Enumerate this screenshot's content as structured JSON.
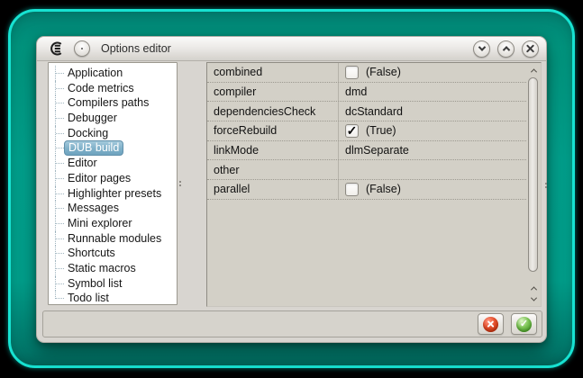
{
  "titlebar": {
    "title": "Options editor"
  },
  "sidebar": {
    "items": [
      {
        "label": "Application"
      },
      {
        "label": "Code metrics"
      },
      {
        "label": "Compilers paths"
      },
      {
        "label": "Debugger"
      },
      {
        "label": "Docking"
      },
      {
        "label": "DUB build",
        "selected": true
      },
      {
        "label": "Editor"
      },
      {
        "label": "Editor pages"
      },
      {
        "label": "Highlighter presets"
      },
      {
        "label": "Messages"
      },
      {
        "label": "Mini explorer"
      },
      {
        "label": "Runnable modules"
      },
      {
        "label": "Shortcuts"
      },
      {
        "label": "Static macros"
      },
      {
        "label": "Symbol list"
      },
      {
        "label": "Todo list"
      }
    ]
  },
  "grid": {
    "rows": [
      {
        "name": "combined",
        "value": "(False)",
        "checkbox": true,
        "check": ""
      },
      {
        "name": "compiler",
        "value": "dmd"
      },
      {
        "name": "dependenciesCheck",
        "value": "dcStandard"
      },
      {
        "name": "forceRebuild",
        "value": "(True)",
        "checkbox": true,
        "check": "✓"
      },
      {
        "name": "linkMode",
        "value": "dlmSeparate"
      },
      {
        "name": "other",
        "value": ""
      },
      {
        "name": "parallel",
        "value": "(False)",
        "checkbox": true,
        "check": ""
      }
    ]
  },
  "footer": {
    "accept_check": "✓"
  },
  "colors": {
    "frame_teal": "#02a28e",
    "frame_cyan": "#17e3d2",
    "selection_blue": "#7fb0c9",
    "cancel_red": "#d63a18",
    "accept_green": "#53ad35",
    "window_bg": "#d8d5d0",
    "grid_bg": "#d3d0c7"
  }
}
